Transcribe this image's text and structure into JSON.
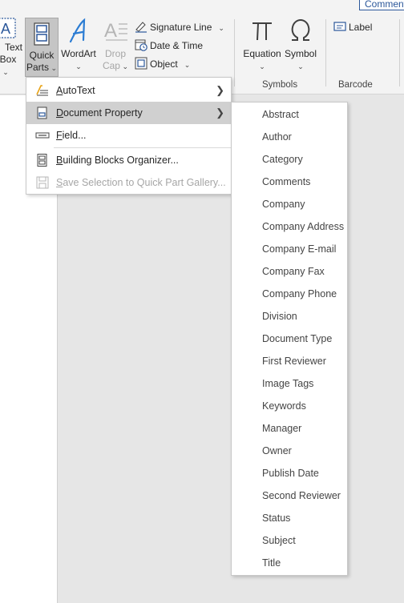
{
  "ribbon": {
    "share_button": "Comments",
    "text_box": {
      "line1": "Text",
      "line2": "Box"
    },
    "quick_parts": {
      "line1": "Quick",
      "line2": "Parts"
    },
    "wordart": {
      "label": "WordArt"
    },
    "drop_cap": {
      "line1": "Drop",
      "line2": "Cap"
    },
    "signature_line": "Signature Line",
    "date_time": "Date & Time",
    "object": "Object",
    "equation": "Equation",
    "symbol": "Symbol",
    "label": "Label",
    "groups": {
      "symbols": "Symbols",
      "barcode": "Barcode"
    }
  },
  "quick_parts_menu": {
    "items": [
      {
        "label": "AutoText",
        "mnemonic": "A",
        "rest": "utoText",
        "has_submenu": true,
        "state": "normal"
      },
      {
        "label": "Document Property",
        "mnemonic": "D",
        "rest": "ocument Property",
        "has_submenu": true,
        "state": "hover"
      },
      {
        "label": "Field...",
        "mnemonic": "F",
        "rest": "ield...",
        "has_submenu": false,
        "state": "normal"
      },
      {
        "label": "Building Blocks Organizer...",
        "mnemonic": "B",
        "rest": "uilding Blocks Organizer...",
        "has_submenu": false,
        "state": "normal"
      },
      {
        "label": "Save Selection to Quick Part Gallery...",
        "mnemonic": "S",
        "rest": "ave Selection to Quick Part Gallery...",
        "has_submenu": false,
        "state": "disabled"
      }
    ]
  },
  "document_property_submenu": {
    "items": [
      "Abstract",
      "Author",
      "Category",
      "Comments",
      "Company",
      "Company Address",
      "Company E-mail",
      "Company Fax",
      "Company Phone",
      "Division",
      "Document Type",
      "First Reviewer",
      "Image Tags",
      "Keywords",
      "Manager",
      "Owner",
      "Publish Date",
      "Second Reviewer",
      "Status",
      "Subject",
      "Title"
    ]
  },
  "icons": {
    "text_box": "text-box-icon",
    "quick_parts": "quick-parts-icon",
    "wordart": "wordart-icon",
    "drop_cap": "drop-cap-icon",
    "signature_line": "signature-line-icon",
    "date_time": "date-time-icon",
    "object": "object-icon",
    "equation": "pi-icon",
    "symbol": "omega-icon",
    "label": "label-icon"
  },
  "colors": {
    "accent": "#2b579a",
    "menu_hover": "#d0d0d0",
    "ribbon_bg": "#f3f3f3",
    "canvas_bg": "#e6e6e6"
  }
}
